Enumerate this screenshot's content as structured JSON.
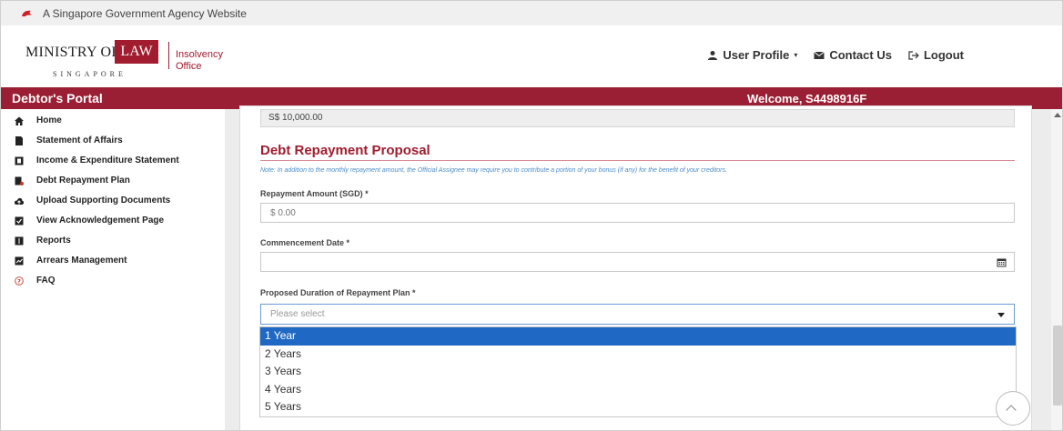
{
  "gov_banner": {
    "text": "A Singapore Government Agency Website"
  },
  "logo": {
    "ministry": "MINISTRY OF",
    "law": "LAW",
    "country": "SINGAPORE",
    "office_line1": "Insolvency",
    "office_line2": "Office"
  },
  "top_nav": {
    "user_profile": "User Profile",
    "contact_us": "Contact Us",
    "logout": "Logout"
  },
  "portal_bar": {
    "title": "Debtor's Portal",
    "welcome": "Welcome, S4498916F"
  },
  "sidebar": {
    "items": [
      {
        "label": "Home",
        "icon": "home-icon"
      },
      {
        "label": "Statement of Affairs",
        "icon": "document-icon"
      },
      {
        "label": "Income & Expenditure Statement",
        "icon": "ledger-icon"
      },
      {
        "label": "Debt Repayment Plan",
        "icon": "plan-icon"
      },
      {
        "label": "Upload Supporting Documents",
        "icon": "upload-icon"
      },
      {
        "label": "View Acknowledgement Page",
        "icon": "acknowledgement-icon"
      },
      {
        "label": "Reports",
        "icon": "reports-icon"
      },
      {
        "label": "Arrears Management",
        "icon": "arrears-icon"
      },
      {
        "label": "FAQ",
        "icon": "question-icon"
      }
    ]
  },
  "form": {
    "prefilled_amount": "S$ 10,000.00",
    "section_title": "Debt Repayment Proposal",
    "note": "Note: In addition to the monthly repayment amount, the Official Assignee may require you to contribute a portion of your bonus (if any) for the benefit of your creditors.",
    "repayment_amount": {
      "label": "Repayment Amount (SGD) *",
      "placeholder": "$ 0.00"
    },
    "commencement_date": {
      "label": "Commencement Date *",
      "value": ""
    },
    "duration": {
      "label": "Proposed Duration of Repayment Plan *",
      "placeholder": "Please select",
      "options": [
        "1 Year",
        "2 Years",
        "3 Years",
        "4 Years",
        "5 Years"
      ],
      "highlighted": "1 Year"
    }
  },
  "colors": {
    "brand_red": "#9b1f34",
    "section_title": "#a01c2e",
    "note_blue": "#4a8cc9",
    "dropdown_highlight": "#1f69c4"
  }
}
